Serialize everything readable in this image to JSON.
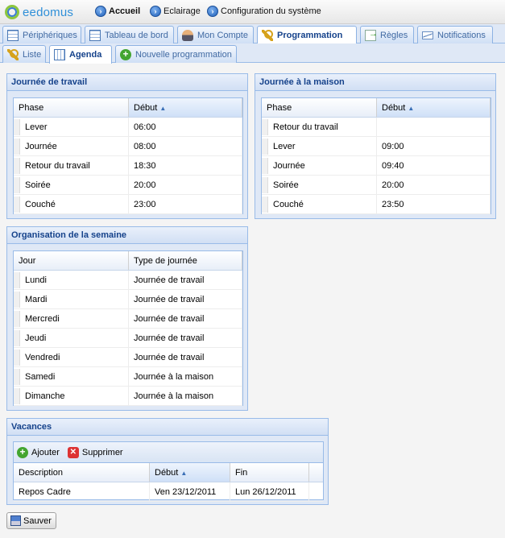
{
  "app": {
    "logo_text": "eedomus"
  },
  "topnav": [
    {
      "label": "Accueil",
      "bold": true
    },
    {
      "label": "Eclairage",
      "bold": false
    },
    {
      "label": "Configuration du système",
      "bold": false
    }
  ],
  "tabs_main": [
    {
      "label": "Périphériques",
      "icon": "grid-icon",
      "active": false
    },
    {
      "label": "Tableau de bord",
      "icon": "dashboard-icon",
      "active": false
    },
    {
      "label": "Mon Compte",
      "icon": "user-icon",
      "active": false
    },
    {
      "label": "Programmation",
      "icon": "key-icon",
      "active": true
    },
    {
      "label": "Règles",
      "icon": "rules-icon",
      "active": false
    },
    {
      "label": "Notifications",
      "icon": "mail-icon",
      "active": false
    }
  ],
  "tabs_sub": [
    {
      "label": "Liste",
      "icon": "key-icon",
      "active": false
    },
    {
      "label": "Agenda",
      "icon": "calendar-icon",
      "active": true
    },
    {
      "label": "Nouvelle programmation",
      "icon": "plus-icon",
      "active": false
    }
  ],
  "work_day": {
    "title": "Journée de travail",
    "col_phase": "Phase",
    "col_start": "Début",
    "rows": [
      {
        "phase": "Lever",
        "start": "06:00"
      },
      {
        "phase": "Journée",
        "start": "08:00"
      },
      {
        "phase": "Retour du travail",
        "start": "18:30"
      },
      {
        "phase": "Soirée",
        "start": "20:00"
      },
      {
        "phase": "Couché",
        "start": "23:00"
      }
    ]
  },
  "home_day": {
    "title": "Journée à la maison",
    "col_phase": "Phase",
    "col_start": "Début",
    "rows": [
      {
        "phase": "Retour du travail",
        "start": ""
      },
      {
        "phase": "Lever",
        "start": "09:00"
      },
      {
        "phase": "Journée",
        "start": "09:40"
      },
      {
        "phase": "Soirée",
        "start": "20:00"
      },
      {
        "phase": "Couché",
        "start": "23:50"
      }
    ]
  },
  "week": {
    "title": "Organisation de la semaine",
    "col_day": "Jour",
    "col_type": "Type de journée",
    "rows": [
      {
        "day": "Lundi",
        "type": "Journée de travail"
      },
      {
        "day": "Mardi",
        "type": "Journée de travail"
      },
      {
        "day": "Mercredi",
        "type": "Journée de travail"
      },
      {
        "day": "Jeudi",
        "type": "Journée de travail"
      },
      {
        "day": "Vendredi",
        "type": "Journée de travail"
      },
      {
        "day": "Samedi",
        "type": "Journée à la maison"
      },
      {
        "day": "Dimanche",
        "type": "Journée à la maison"
      }
    ]
  },
  "holidays": {
    "title": "Vacances",
    "add_label": "Ajouter",
    "delete_label": "Supprimer",
    "col_desc": "Description",
    "col_start": "Début",
    "col_end": "Fin",
    "rows": [
      {
        "desc": "Repos Cadre",
        "start": "Ven 23/12/2011",
        "end": "Lun 26/12/2011"
      }
    ]
  },
  "save_label": "Sauver"
}
